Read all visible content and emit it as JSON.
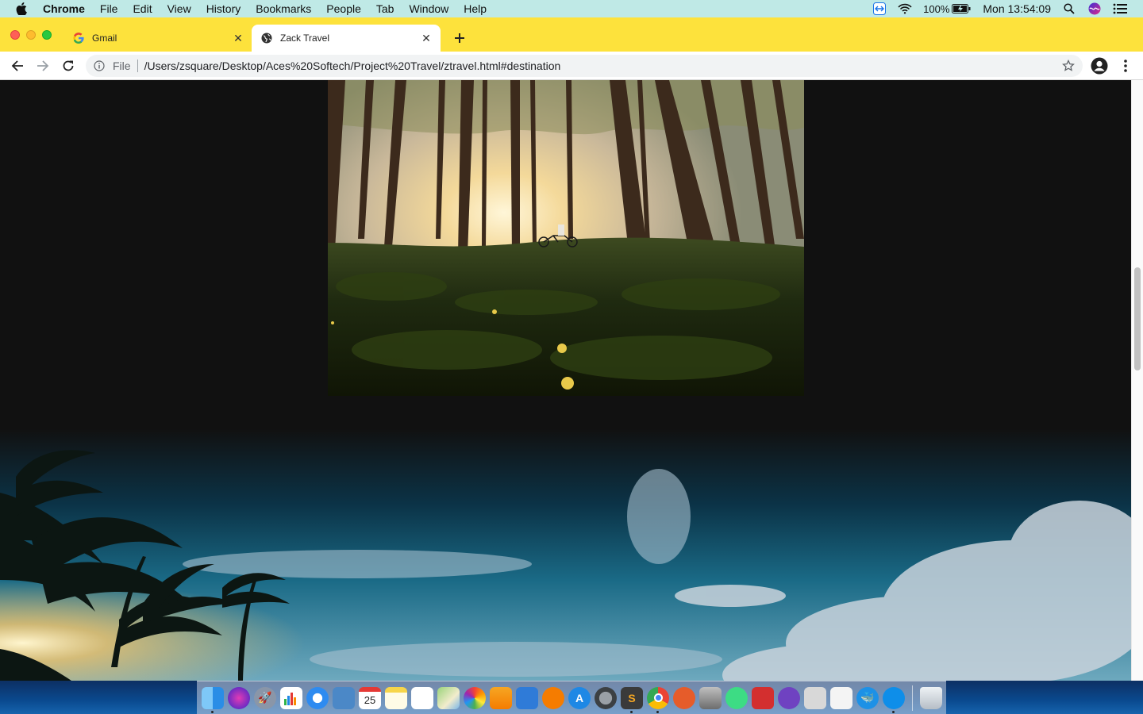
{
  "menubar": {
    "app_name": "Chrome",
    "items": [
      "File",
      "Edit",
      "View",
      "History",
      "Bookmarks",
      "People",
      "Tab",
      "Window",
      "Help"
    ],
    "battery": "100%",
    "clock": "Mon 13:54:09"
  },
  "tabs": [
    {
      "title": "Gmail",
      "active": false
    },
    {
      "title": "Zack Travel",
      "active": true
    }
  ],
  "toolbar": {
    "scheme_label": "File",
    "url": "/Users/zsquare/Desktop/Aces%20Softech/Project%20Travel/ztravel.html#destination"
  },
  "dock": {
    "calendar_day": "25",
    "apps": [
      "finder",
      "siri",
      "launchpad",
      "numbers",
      "safari",
      "preview",
      "calendar",
      "notes",
      "reminders",
      "maps",
      "photos",
      "pages",
      "keynote",
      "books",
      "app-store",
      "system-preferences",
      "sublime-text",
      "chrome",
      "xcode-instruments",
      "archive",
      "android-studio",
      "acrobat",
      "github-desktop",
      "image-capture",
      "textedit",
      "docker",
      "teamviewer",
      "trash"
    ]
  },
  "colors": {
    "menubar": "#bfe9e6",
    "tabstrip": "#fde23c",
    "page_background": "#111111"
  }
}
